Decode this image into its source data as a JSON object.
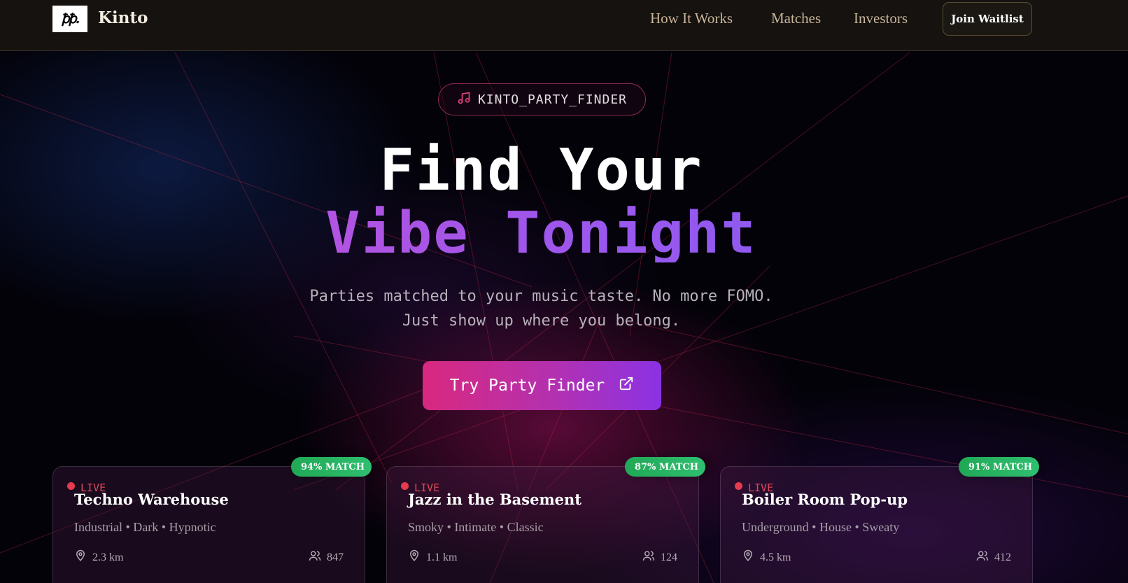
{
  "nav": {
    "logo_mark": "ꝥꝥ.",
    "brand": "Kinto",
    "links": [
      "How It Works",
      "Matches",
      "Investors"
    ],
    "cta": "Join Waitlist"
  },
  "hero": {
    "badge": "KINTO_PARTY_FINDER",
    "badge_icon": "music-note-icon",
    "title_line1": "Find Your",
    "title_line2": "Vibe Tonight",
    "subtitle_line1": "Parties matched to your music taste. No more FOMO.",
    "subtitle_line2": "Just show up where you belong.",
    "cta": "Try Party Finder",
    "cta_icon": "external-link-icon"
  },
  "cards": [
    {
      "match": "94% MATCH",
      "status": "LIVE",
      "title": "Techno Warehouse",
      "tags": "Industrial • Dark • Hypnotic",
      "distance": "2.3 km",
      "attendees": "847"
    },
    {
      "match": "87% MATCH",
      "status": "LIVE",
      "title": "Jazz in the Basement",
      "tags": "Smoky • Intimate • Classic",
      "distance": "1.1 km",
      "attendees": "124"
    },
    {
      "match": "91% MATCH",
      "status": "LIVE",
      "title": "Boiler Room Pop-up",
      "tags": "Underground • House • Sweaty",
      "distance": "4.5 km",
      "attendees": "412"
    }
  ],
  "colors": {
    "accent_pink": "#d9287f",
    "accent_purple": "#8b32e4",
    "match_green": "#2fbf70",
    "live_red": "#e53b4e",
    "nav_bg": "#15120f"
  }
}
